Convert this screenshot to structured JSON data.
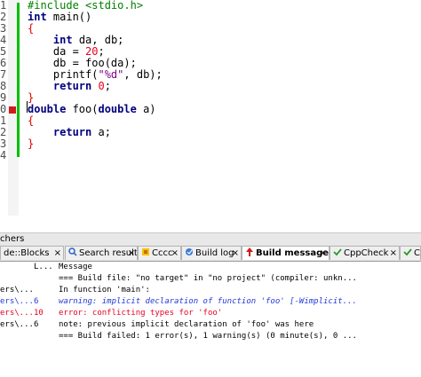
{
  "editor": {
    "line_numbers": [
      "1",
      "2",
      "3",
      "4",
      "5",
      "6",
      "7",
      "8",
      "9",
      "0",
      "1",
      "2",
      "3",
      "4"
    ],
    "lines": [
      [
        {
          "t": "#include <stdio.h>",
          "c": "pp"
        }
      ],
      [
        {
          "t": "int",
          "c": "kw"
        },
        {
          "t": " main()",
          "c": "plain"
        }
      ],
      [
        {
          "t": "{",
          "c": "brace"
        }
      ],
      [
        {
          "t": "    ",
          "c": "plain"
        },
        {
          "t": "int",
          "c": "kw"
        },
        {
          "t": " da, db;",
          "c": "plain"
        }
      ],
      [
        {
          "t": "    da = ",
          "c": "plain"
        },
        {
          "t": "20",
          "c": "num"
        },
        {
          "t": ";",
          "c": "plain"
        }
      ],
      [
        {
          "t": "    db = foo(da);",
          "c": "plain"
        }
      ],
      [
        {
          "t": "    printf(",
          "c": "plain"
        },
        {
          "t": "\"%d\"",
          "c": "str"
        },
        {
          "t": ", db);",
          "c": "plain"
        }
      ],
      [
        {
          "t": "    ",
          "c": "plain"
        },
        {
          "t": "return",
          "c": "kw"
        },
        {
          "t": " ",
          "c": "plain"
        },
        {
          "t": "0",
          "c": "num"
        },
        {
          "t": ";",
          "c": "plain"
        }
      ],
      [
        {
          "t": "}",
          "c": "brace"
        }
      ],
      [
        {
          "t": "double",
          "c": "kw"
        },
        {
          "t": " foo(",
          "c": "plain"
        },
        {
          "t": "double",
          "c": "kw"
        },
        {
          "t": " a)",
          "c": "plain"
        }
      ],
      [
        {
          "t": "{",
          "c": "brace"
        }
      ],
      [
        {
          "t": "    ",
          "c": "plain"
        },
        {
          "t": "return",
          "c": "kw"
        },
        {
          "t": " a;",
          "c": "plain"
        }
      ],
      [
        {
          "t": "}",
          "c": "brace"
        }
      ],
      [
        {
          "t": "",
          "c": "plain"
        }
      ]
    ]
  },
  "panel": {
    "title": "chers",
    "tabs": [
      {
        "label": "de::Blocks",
        "icon": "none"
      },
      {
        "label": "Search results",
        "icon": "search-icon"
      },
      {
        "label": "Cccc",
        "icon": "cccc-icon"
      },
      {
        "label": "Build log",
        "icon": "build-log-icon"
      },
      {
        "label": "Build messages",
        "icon": "build-messages-icon",
        "active": true
      },
      {
        "label": "CppCheck",
        "icon": "cppcheck-icon"
      },
      {
        "label": "C",
        "icon": "cscope-icon"
      }
    ],
    "close_glyph": "×"
  },
  "messages": {
    "header": {
      "file": "",
      "line": "L...",
      "message": "Message"
    },
    "rows": [
      {
        "file": "",
        "line": "",
        "message": "=== Build file: \"no target\" in \"no project\" (compiler: unkn...",
        "kind": "normal"
      },
      {
        "file": "ers\\...",
        "line": "",
        "message": "In function 'main':",
        "kind": "normal"
      },
      {
        "file": "ers\\...",
        "line": "6",
        "message": "warning: implicit declaration of function 'foo' [-Wimplicit...",
        "kind": "warning"
      },
      {
        "file": "ers\\...",
        "line": "10",
        "message": "error: conflicting types for 'foo'",
        "kind": "error"
      },
      {
        "file": "ers\\...",
        "line": "6",
        "message": "note: previous implicit declaration of 'foo' was here",
        "kind": "normal"
      },
      {
        "file": "",
        "line": "",
        "message": "=== Build failed: 1 error(s), 1 warning(s) (0 minute(s), 0 ...",
        "kind": "normal"
      }
    ]
  },
  "colors": {
    "keyword": "#00007f",
    "preprocessor": "#008000",
    "number": "#e8001e",
    "string": "#7f007f",
    "brace": "#e00000",
    "warning": "#1f3ad8",
    "error": "#e8001e",
    "change_bar": "#00c000",
    "breakpoint": "#d11a1a"
  }
}
